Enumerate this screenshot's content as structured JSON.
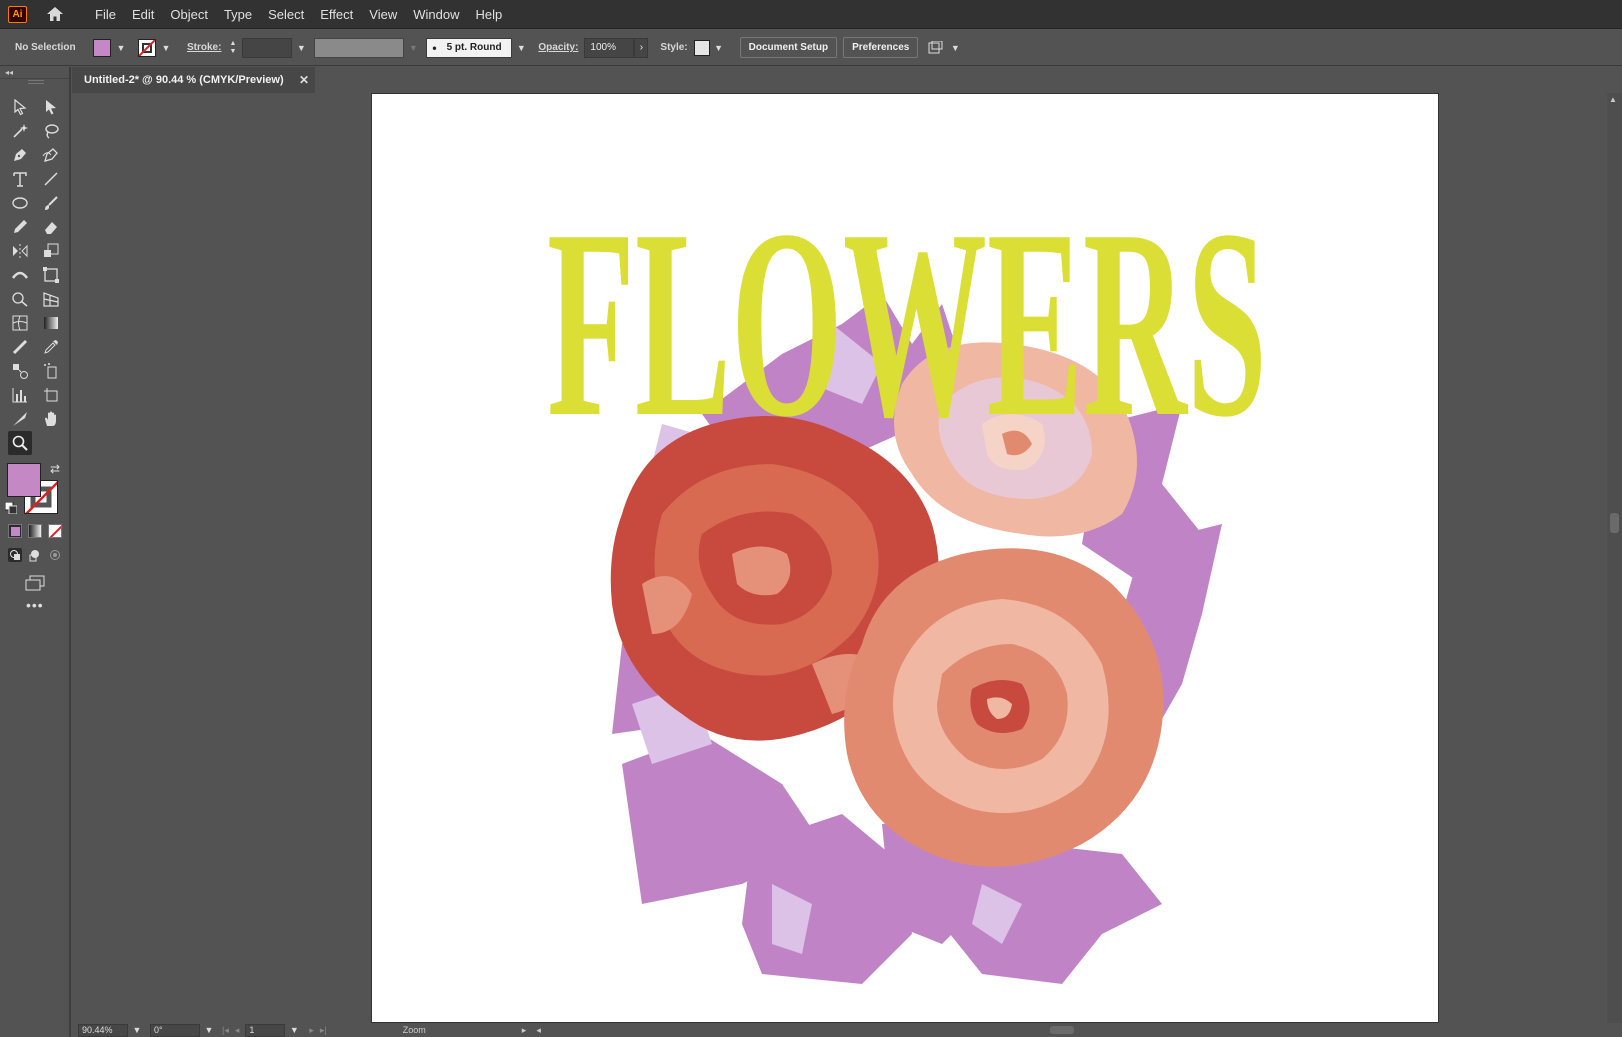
{
  "app": {
    "logo_text": "Ai",
    "brand_color": "#ff9a00"
  },
  "menu": {
    "items": [
      "File",
      "Edit",
      "Object",
      "Type",
      "Select",
      "Effect",
      "View",
      "Window",
      "Help"
    ]
  },
  "control_bar": {
    "selection_label": "No Selection",
    "fill_color": "#c489c4",
    "stroke_label": "Stroke:",
    "brush_label": "5 pt. Round",
    "opacity_label": "Opacity:",
    "opacity_value": "100%",
    "style_label": "Style:",
    "document_setup": "Document Setup",
    "preferences": "Preferences"
  },
  "document": {
    "tab_title": "Untitled-2* @ 90.44 % (CMYK/Preview)",
    "close_icon": "close-icon"
  },
  "artwork": {
    "headline": "FLOWERS",
    "headline_color": "#dbde35",
    "rose_red": "#c84a3e",
    "rose_coral": "#e18a6f",
    "rose_peach": "#f0b7a2",
    "leaf_purple": "#c084c6",
    "leaf_light": "#dcc2e6"
  },
  "status_bar": {
    "zoom": "90.44%",
    "rotation": "0°",
    "artboard": "1",
    "tool_name": "Zoom"
  }
}
